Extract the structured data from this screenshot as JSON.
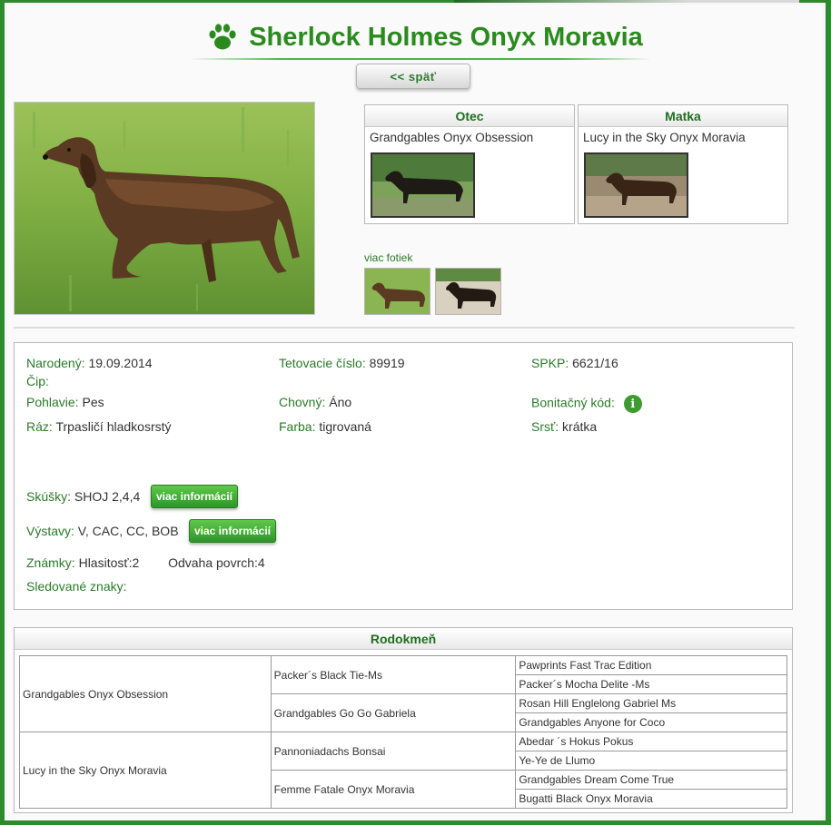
{
  "header": {
    "title": "Sherlock Holmes Onyx Moravia",
    "back_label": "<<   späť"
  },
  "parents": {
    "father": {
      "heading": "Otec",
      "name": "Grandgables Onyx Obsession"
    },
    "mother": {
      "heading": "Matka",
      "name": "Lucy in the Sky Onyx Moravia"
    }
  },
  "more_photos_label": "viac fotiek",
  "info": {
    "born": {
      "label": "Narodený:",
      "value": "19.09.2014"
    },
    "chip": {
      "label": "Čip:",
      "value": ""
    },
    "sex": {
      "label": "Pohlavie:",
      "value": "Pes"
    },
    "variety": {
      "label": "Ráz:",
      "value": "Trpasličí hladkosrstý"
    },
    "tattoo": {
      "label": "Tetovacie číslo:",
      "value": "89919"
    },
    "breeding": {
      "label": "Chovný:",
      "value": "Áno"
    },
    "color": {
      "label": "Farba:",
      "value": "tigrovaná"
    },
    "spkp": {
      "label": "SPKP:",
      "value": "6621/16"
    },
    "bonitation": {
      "label": "Bonitačný kód:",
      "icon": "info-icon"
    },
    "coat": {
      "label": "Srsť:",
      "value": "krátka"
    },
    "exams": {
      "label": "Skúšky:",
      "value": "SHOJ 2,4,4",
      "button": "viac informácií"
    },
    "shows": {
      "label": "Výstavy:",
      "value": "V, CAC, CC, BOB",
      "button": "viac informácií"
    },
    "marks": {
      "label": "Známky:",
      "value1": "Hlasitosť:2",
      "value2": "Odvaha povrch:4"
    },
    "tracked": {
      "label": "Sledované znaky:",
      "value": ""
    }
  },
  "pedigree": {
    "heading": "Rodokmeň",
    "gen1": [
      "Grandgables Onyx Obsession",
      "Lucy in the Sky Onyx Moravia"
    ],
    "gen2": [
      "Packer´s Black Tie-Ms",
      "Grandgables Go Go Gabriela",
      "Pannoniadachs Bonsai",
      "Femme Fatale Onyx Moravia"
    ],
    "gen3": [
      "Pawprints Fast Trac Edition",
      "Packer´s Mocha Delite -Ms",
      "Rosan Hill Englelong Gabriel Ms",
      "Grandgables Anyone for Coco",
      "Abedar ´s Hokus Pokus",
      "Ye-Ye de Llumo",
      "Grandgables Dream Come True",
      "Bugatti Black Onyx Moravia"
    ]
  },
  "colors": {
    "accent": "#2a8a1e",
    "frame": "#2d8a2d"
  }
}
